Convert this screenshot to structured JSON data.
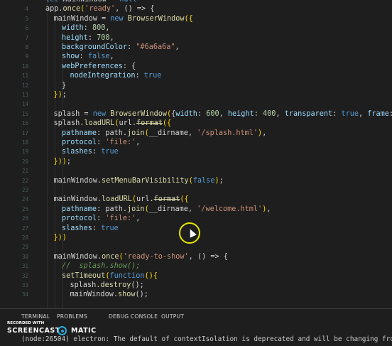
{
  "editor": {
    "lines": [
      {
        "n": "",
        "indent": 0,
        "tokens": [
          [
            "kw",
            "let "
          ],
          [
            "plain",
            "mainWindow = "
          ],
          [
            "kw",
            "null"
          ]
        ]
      },
      {
        "n": "4",
        "indent": 0,
        "tokens": [
          [
            "plain",
            "app."
          ],
          [
            "fn",
            "once"
          ],
          [
            "punc",
            "("
          ],
          [
            "str",
            "'ready'"
          ],
          [
            "plain",
            ", () => {"
          ]
        ]
      },
      {
        "n": "5",
        "indent": 1,
        "tokens": [
          [
            "plain",
            "mainWindow = "
          ],
          [
            "kw",
            "new "
          ],
          [
            "fn",
            "BrowserWindow"
          ],
          [
            "punc",
            "({"
          ]
        ]
      },
      {
        "n": "6",
        "indent": 2,
        "tokens": [
          [
            "prop",
            "width"
          ],
          [
            "plain",
            ": "
          ],
          [
            "num",
            "800"
          ],
          [
            "plain",
            ","
          ]
        ]
      },
      {
        "n": "7",
        "indent": 2,
        "tokens": [
          [
            "prop",
            "height"
          ],
          [
            "plain",
            ": "
          ],
          [
            "num",
            "700"
          ],
          [
            "plain",
            ","
          ]
        ]
      },
      {
        "n": "8",
        "indent": 2,
        "tokens": [
          [
            "prop",
            "backgroundColor"
          ],
          [
            "plain",
            ": "
          ],
          [
            "str",
            "\"#6a6a6a\""
          ],
          [
            "plain",
            ","
          ]
        ]
      },
      {
        "n": "9",
        "indent": 2,
        "tokens": [
          [
            "prop",
            "show"
          ],
          [
            "plain",
            ": "
          ],
          [
            "kw",
            "false"
          ],
          [
            "plain",
            ","
          ]
        ]
      },
      {
        "n": "10",
        "indent": 2,
        "tokens": [
          [
            "prop",
            "webPreferences"
          ],
          [
            "plain",
            ": {"
          ]
        ]
      },
      {
        "n": "11",
        "indent": 3,
        "tokens": [
          [
            "prop",
            "nodeIntegration"
          ],
          [
            "plain",
            ": "
          ],
          [
            "kw",
            "true"
          ]
        ]
      },
      {
        "n": "12",
        "indent": 2,
        "tokens": [
          [
            "plain",
            "}"
          ]
        ]
      },
      {
        "n": "13",
        "indent": 1,
        "tokens": [
          [
            "punc",
            "})"
          ],
          [
            "plain",
            ";"
          ]
        ]
      },
      {
        "n": "14",
        "indent": 0,
        "tokens": []
      },
      {
        "n": "15",
        "indent": 1,
        "tokens": [
          [
            "plain",
            "splash = "
          ],
          [
            "kw",
            "new "
          ],
          [
            "fn",
            "BrowserWindow"
          ],
          [
            "punc",
            "("
          ],
          [
            "plain",
            "{"
          ],
          [
            "prop",
            "width"
          ],
          [
            "plain",
            ": "
          ],
          [
            "num",
            "600"
          ],
          [
            "plain",
            ", "
          ],
          [
            "prop",
            "height"
          ],
          [
            "plain",
            ": "
          ],
          [
            "num",
            "400"
          ],
          [
            "plain",
            ", "
          ],
          [
            "prop",
            "transparent"
          ],
          [
            "plain",
            ": "
          ],
          [
            "kw",
            "true"
          ],
          [
            "plain",
            ", "
          ],
          [
            "prop",
            "frame"
          ],
          [
            "plain",
            ": "
          ],
          [
            "kw",
            "false"
          ],
          [
            "plain",
            ", al"
          ]
        ]
      },
      {
        "n": "16",
        "indent": 1,
        "tokens": [
          [
            "plain",
            "splash."
          ],
          [
            "fn",
            "loadURL"
          ],
          [
            "punc",
            "("
          ],
          [
            "plain",
            "url."
          ],
          [
            "strike",
            "format"
          ],
          [
            "punc",
            "({"
          ]
        ]
      },
      {
        "n": "17",
        "indent": 2,
        "tokens": [
          [
            "prop",
            "pathname"
          ],
          [
            "plain",
            ": path."
          ],
          [
            "fn",
            "join"
          ],
          [
            "punc",
            "("
          ],
          [
            "plain",
            "__dirname, "
          ],
          [
            "str",
            "'/splash.html'"
          ],
          [
            "punc",
            ")"
          ],
          [
            "plain",
            ","
          ]
        ]
      },
      {
        "n": "18",
        "indent": 2,
        "tokens": [
          [
            "prop",
            "protocol"
          ],
          [
            "plain",
            ": "
          ],
          [
            "str",
            "'file:'"
          ],
          [
            "plain",
            ","
          ]
        ]
      },
      {
        "n": "19",
        "indent": 2,
        "tokens": [
          [
            "prop",
            "slashes"
          ],
          [
            "plain",
            ": "
          ],
          [
            "kw",
            "true"
          ]
        ]
      },
      {
        "n": "20",
        "indent": 1,
        "tokens": [
          [
            "punc",
            "}))"
          ],
          [
            "plain",
            ";"
          ]
        ]
      },
      {
        "n": "21",
        "indent": 0,
        "tokens": []
      },
      {
        "n": "22",
        "indent": 1,
        "tokens": [
          [
            "plain",
            "mainWindow."
          ],
          [
            "fn",
            "setMenuBarVisibility"
          ],
          [
            "punc",
            "("
          ],
          [
            "kw",
            "false"
          ],
          [
            "punc",
            ")"
          ],
          [
            "plain",
            ";"
          ]
        ]
      },
      {
        "n": "23",
        "indent": 0,
        "tokens": []
      },
      {
        "n": "24",
        "indent": 1,
        "tokens": [
          [
            "plain",
            "mainWindow."
          ],
          [
            "fn",
            "loadURL"
          ],
          [
            "punc",
            "("
          ],
          [
            "plain",
            "url."
          ],
          [
            "strike",
            "format"
          ],
          [
            "punc",
            "({"
          ]
        ]
      },
      {
        "n": "25",
        "indent": 2,
        "tokens": [
          [
            "prop",
            "pathname"
          ],
          [
            "plain",
            ": path."
          ],
          [
            "fn",
            "join"
          ],
          [
            "punc",
            "("
          ],
          [
            "plain",
            "__dirname, "
          ],
          [
            "str",
            "'/welcome.html'"
          ],
          [
            "punc",
            ")"
          ],
          [
            "plain",
            ","
          ]
        ]
      },
      {
        "n": "26",
        "indent": 2,
        "tokens": [
          [
            "prop",
            "protocol"
          ],
          [
            "plain",
            ": "
          ],
          [
            "str",
            "'file:'"
          ],
          [
            "plain",
            ","
          ]
        ]
      },
      {
        "n": "27",
        "indent": 2,
        "tokens": [
          [
            "prop",
            "slashes"
          ],
          [
            "plain",
            ": "
          ],
          [
            "kw",
            "true"
          ]
        ]
      },
      {
        "n": "28",
        "indent": 1,
        "tokens": [
          [
            "punc",
            "}))"
          ]
        ]
      },
      {
        "n": "29",
        "indent": 0,
        "tokens": []
      },
      {
        "n": "30",
        "indent": 1,
        "tokens": [
          [
            "plain",
            "mainWindow."
          ],
          [
            "fn",
            "once"
          ],
          [
            "punc",
            "("
          ],
          [
            "str",
            "'ready-to-show'"
          ],
          [
            "plain",
            ", () => {"
          ]
        ]
      },
      {
        "n": "31",
        "indent": 2,
        "tokens": [
          [
            "cmt",
            "//  splash.show();"
          ]
        ]
      },
      {
        "n": "32",
        "indent": 2,
        "tokens": [
          [
            "fn",
            "setTimeout"
          ],
          [
            "punc",
            "("
          ],
          [
            "kw",
            "function"
          ],
          [
            "punc",
            "(){"
          ]
        ]
      },
      {
        "n": "33",
        "indent": 3,
        "tokens": [
          [
            "plain",
            "splash."
          ],
          [
            "fn",
            "destroy"
          ],
          [
            "plain",
            "();"
          ]
        ]
      },
      {
        "n": "34",
        "indent": 3,
        "tokens": [
          [
            "plain",
            "mainWindow."
          ],
          [
            "fn",
            "show"
          ],
          [
            "plain",
            "();"
          ]
        ]
      }
    ]
  },
  "panel": {
    "tabs": [
      "TERMINAL",
      "PROBLEMS",
      "DEBUG CONSOLE",
      "OUTPUT"
    ],
    "terminal_output": "(node:26504) electron: The default of contextIsolation is deprecated and will be changing from false to"
  },
  "watermark": {
    "recorded_with": "RECORDED WITH",
    "brand_left": "SCREENCAST",
    "brand_right": "MATIC"
  },
  "colors": {
    "keyword": "#569cd6",
    "function": "#dcdcaa",
    "string": "#ce9178",
    "number": "#b5cea8",
    "property": "#9cdcfe",
    "cursor_ring": "#e6e600"
  }
}
